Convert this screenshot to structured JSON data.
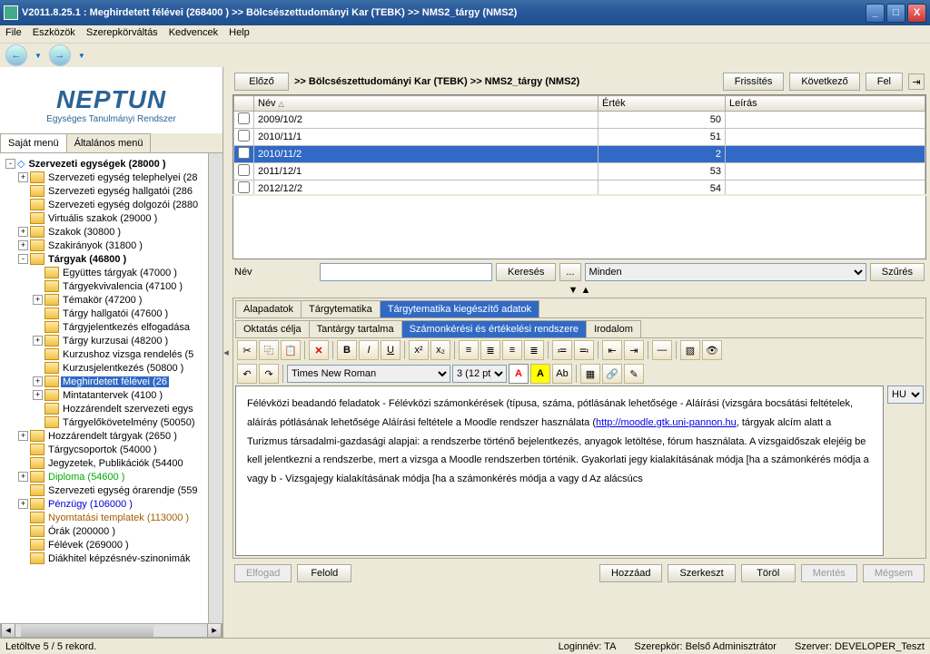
{
  "window": {
    "title": "V2011.8.25.1 : Meghirdetett félévei (268400 ) >> Bölcsészettudományi Kar (TEBK) >> NMS2_tárgy (NMS2)",
    "min": "_",
    "max": "□",
    "close": "X"
  },
  "menu": {
    "file": "File",
    "tools": "Eszközök",
    "role": "Szerepkörváltás",
    "fav": "Kedvencek",
    "help": "Help"
  },
  "logo": {
    "brand": "NEPTUN",
    "sub": "Egységes Tanulmányi Rendszer"
  },
  "leftTabs": {
    "own": "Saját menü",
    "gen": "Általános menü"
  },
  "tree": {
    "root": "Szervezeti egységek (28000 )",
    "n1": "Szervezeti egység telephelyei (28",
    "n2": "Szervezeti egység hallgatói (286",
    "n3": "Szervezeti egység dolgozói (2880",
    "n4": "Virtuális szakok (29000 )",
    "n5": "Szakok (30800 )",
    "n6": "Szakirányok (31800 )",
    "n7": "Tárgyak (46800 )",
    "n71": "Együttes tárgyak (47000 )",
    "n72": "Tárgyekvivalencia (47100 )",
    "n73": "Témakör (47200 )",
    "n74": "Tárgy hallgatói (47600 )",
    "n75": "Tárgyjelentkezés elfogadása",
    "n76": "Tárgy kurzusai (48200 )",
    "n77": "Kurzushoz vizsga rendelés (5",
    "n78": "Kurzusjelentkezés (50800 )",
    "n79": "Meghirdetett félévei (26",
    "n710": "Mintatantervek (4100 )",
    "n711": "Hozzárendelt szervezeti egys",
    "n712": "Tárgyelőkövetelmény (50050)",
    "n8": "Hozzárendelt tárgyak (2650 )",
    "n9": "Tárgycsoportok (54000 )",
    "n10": "Jegyzetek, Publikációk (54400",
    "n11": "Diploma (54600 )",
    "n12": "Szervezeti egység órarendje (559",
    "n13": "Pénzügy (106000 )",
    "n14": "Nyomtatási templatek (113000 )",
    "n15": "Órák (200000 )",
    "n16": "Félévek (269000 )",
    "n17": "Diákhitel képzésnév-szinonimák"
  },
  "top": {
    "prev": "Előző",
    "bc": ">> Bölcsészettudományi Kar (TEBK) >> NMS2_tárgy (NMS2)",
    "refresh": "Frissítés",
    "next": "Következő",
    "up": "Fel"
  },
  "gridH": {
    "name": "Név",
    "value": "Érték",
    "desc": "Leírás"
  },
  "gridR": [
    {
      "name": "2009/10/2",
      "value": "50",
      "sel": false
    },
    {
      "name": "2010/11/1",
      "value": "51",
      "sel": false
    },
    {
      "name": "2010/11/2",
      "value": "2",
      "sel": true
    },
    {
      "name": "2011/12/1",
      "value": "53",
      "sel": false
    },
    {
      "name": "2012/12/2",
      "value": "54",
      "sel": false
    }
  ],
  "search": {
    "label": "Név",
    "btn": "Keresés",
    "all": "Minden",
    "filter": "Szűrés",
    "dots": "..."
  },
  "tabsA": {
    "a": "Alapadatok",
    "b": "Tárgytematika",
    "c": "Tárgytematika kiegészítő adatok"
  },
  "tabsB": {
    "a": "Oktatás célja",
    "b": "Tantárgy tartalma",
    "c": "Számonkérési és értékelési rendszere",
    "d": "Irodalom"
  },
  "font": {
    "family": "Times New Roman",
    "size": "3 (12 pt)"
  },
  "lang": "HU",
  "editor": {
    "text1": "Félévközi beadandó feladatok - Félévközi számonkérések (típusa, száma, pótlásának lehetősége - Aláírási (vizsgára bocsátási feltételek, aláírás pótlásának lehetősége Aláírási feltétele a Moodle rendszer használata (",
    "link": "http://moodle.gtk.uni-pannon.hu",
    "text2": ", tárgyak alcím alatt a Turizmus társadalmi-gazdasági alapjai: a rendszerbe történő bejelentkezés, anyagok letöltése, fórum használata. A vizsgaidőszak elejéig be kell jelentkezni a rendszerbe, mert a vizsga a Moodle rendszerben történik. Gyakorlati jegy kialakításának módja [ha a számonkérés módja a vagy b - Vizsgajegy kialakításának módja [ha a számonkérés módja a vagy d Az alácsúcs"
  },
  "actions": {
    "accept": "Elfogad",
    "release": "Felold",
    "add": "Hozzáad",
    "edit": "Szerkeszt",
    "del": "Töröl",
    "save": "Mentés",
    "cancel": "Mégsem"
  },
  "status": {
    "loaded": "Letöltve 5 / 5 rekord.",
    "login": "Loginnév: TA",
    "role": "Szerepkör: Belső Adminisztrátor",
    "server": "Szerver: DEVELOPER_Teszt"
  }
}
